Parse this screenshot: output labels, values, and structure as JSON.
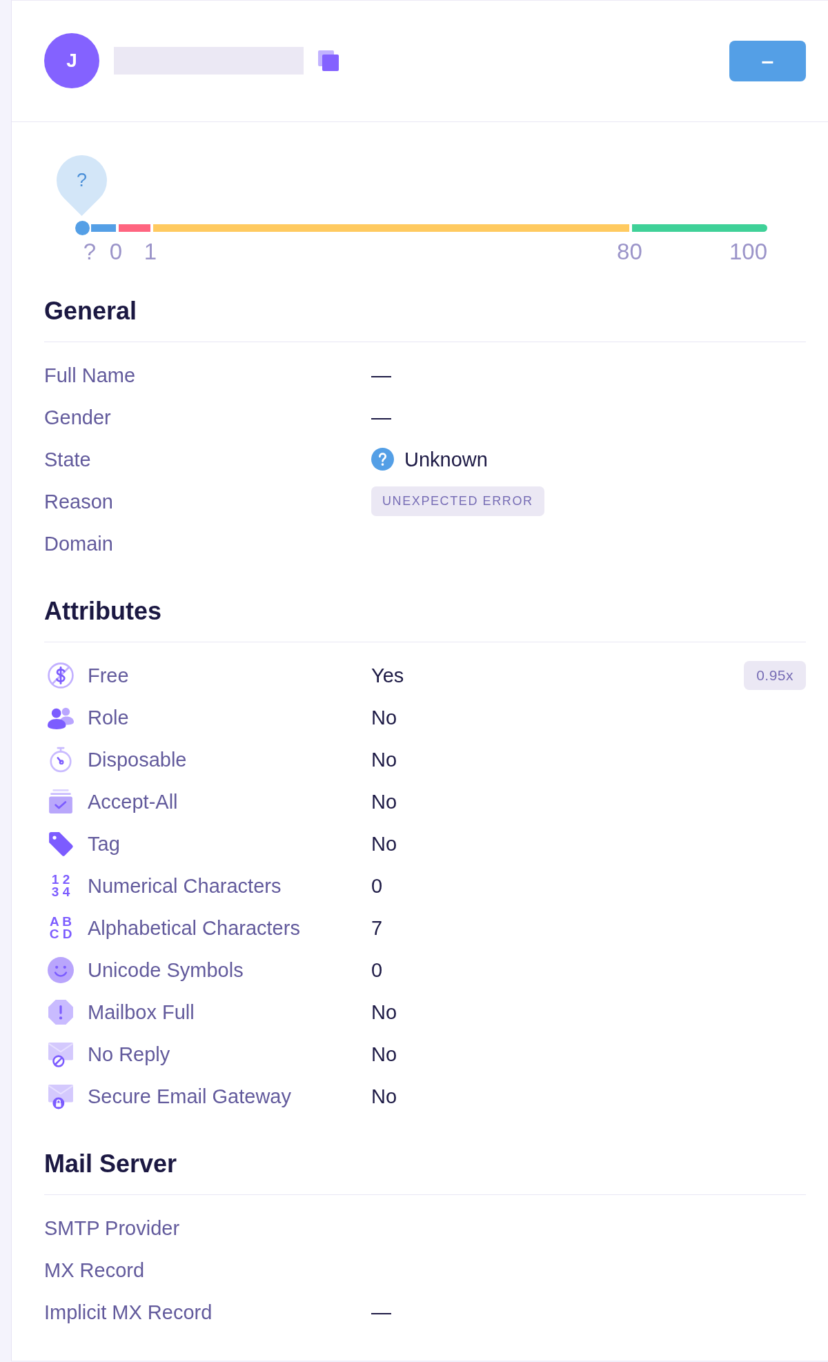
{
  "header": {
    "avatar_initial": "J",
    "button_label": "–"
  },
  "score": {
    "pin_label": "?",
    "marker_tick": "?",
    "segments": [
      {
        "color": "#549fe6",
        "tick": "0"
      },
      {
        "color": "#ff6580",
        "tick": "1"
      },
      {
        "color": "#ffca60",
        "tick": "80"
      },
      {
        "color": "#3fd198",
        "tick": "100"
      }
    ]
  },
  "general": {
    "title": "General",
    "rows": [
      {
        "kind": "text",
        "label": "Full Name",
        "value": "—"
      },
      {
        "kind": "text",
        "label": "Gender",
        "value": "—"
      },
      {
        "kind": "status",
        "label": "State",
        "value": "Unknown"
      },
      {
        "kind": "badge",
        "label": "Reason",
        "value": "UNEXPECTED ERROR"
      },
      {
        "kind": "text",
        "label": "Domain"
      }
    ]
  },
  "attributes": {
    "title": "Attributes",
    "rows": [
      {
        "label": "Free",
        "value": "Yes",
        "multiplier": "0.95x"
      },
      {
        "label": "Role",
        "value": "No"
      },
      {
        "label": "Disposable",
        "value": "No"
      },
      {
        "label": "Accept-All",
        "value": "No"
      },
      {
        "label": "Tag",
        "value": "No"
      },
      {
        "label": "Numerical Characters",
        "value": "0",
        "icon_text": [
          "1 2",
          "3 4"
        ]
      },
      {
        "label": "Alphabetical Characters",
        "value": "7",
        "icon_text": [
          "A B",
          "C D"
        ]
      },
      {
        "label": "Unicode Symbols",
        "value": "0"
      },
      {
        "label": "Mailbox Full",
        "value": "No"
      },
      {
        "label": "No Reply",
        "value": "No"
      },
      {
        "label": "Secure Email Gateway",
        "value": "No"
      }
    ]
  },
  "mail_server": {
    "title": "Mail Server",
    "rows": [
      {
        "kind": "text",
        "label": "SMTP Provider"
      },
      {
        "kind": "text",
        "label": "MX Record"
      },
      {
        "kind": "text",
        "label": "Implicit MX Record",
        "value": "—"
      }
    ]
  }
}
